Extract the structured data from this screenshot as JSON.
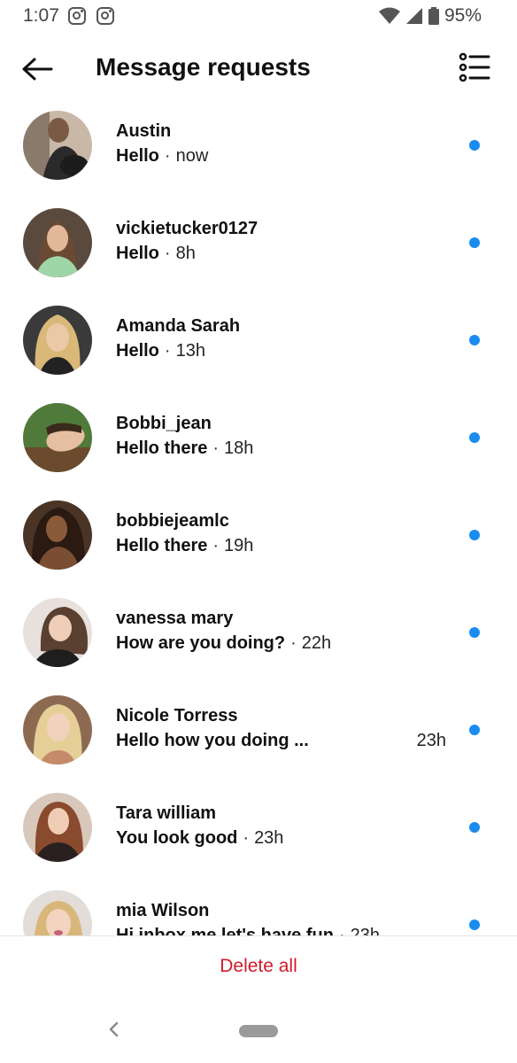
{
  "status_bar": {
    "time": "1:07",
    "notification_icons": [
      "instagram-icon",
      "instagram-icon"
    ],
    "system_icons": [
      "wifi-icon",
      "signal-icon",
      "battery-icon"
    ],
    "battery_percent": "95%"
  },
  "header": {
    "title": "Message requests",
    "back_icon": "arrow-left-icon",
    "filter_icon": "list-filter-icon"
  },
  "requests": [
    {
      "name": "Austin",
      "message": "Hello",
      "time": "now",
      "unread": true
    },
    {
      "name": "vickietucker0127",
      "message": "Hello",
      "time": "8h",
      "unread": true
    },
    {
      "name": "Amanda Sarah",
      "message": "Hello",
      "time": "13h",
      "unread": true
    },
    {
      "name": "Bobbi_jean",
      "message": "Hello there",
      "time": "18h",
      "unread": true
    },
    {
      "name": "bobbiejeamlc",
      "message": "Hello there",
      "time": "19h",
      "unread": true
    },
    {
      "name": "vanessa mary",
      "message": "How are you doing?",
      "time": "22h",
      "unread": true
    },
    {
      "name": "Nicole Torress",
      "message": "Hello how you doing ...",
      "time": "23h",
      "unread": true
    },
    {
      "name": "Tara william",
      "message": "You look good",
      "time": "23h",
      "unread": true
    },
    {
      "name": "mia Wilson",
      "message": "Hi inbox me let's have fun",
      "time": "23h",
      "unread": true
    }
  ],
  "footer": {
    "delete_all_label": "Delete all"
  },
  "colors": {
    "unread_dot": "#1a8cf0",
    "delete_text": "#d11a2a"
  }
}
